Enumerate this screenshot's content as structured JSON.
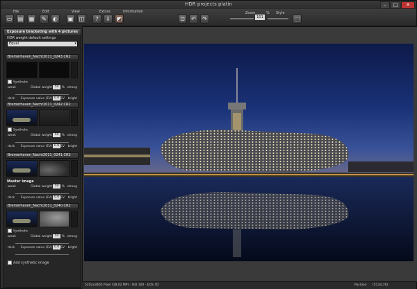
{
  "window": {
    "title": "HDR projects platin",
    "minimize": "–",
    "maximize": "□",
    "close": "✕"
  },
  "menu": [
    "File",
    "Edit",
    "View",
    "Extras",
    "Information"
  ],
  "toolbar": {
    "zoom_label": "Zoom",
    "zoom_value": "101",
    "zoom_unit": "%",
    "style_label": "Style"
  },
  "panel": {
    "title": "Exposure bracketing with 4 pictures",
    "weight_header": "HDR weight default settings",
    "weight_select": "Equal",
    "groups": [
      {
        "filename": "Bremerhaven_Nacht2011_0243.CR2",
        "synthetic": "Synthetic",
        "global_weight_label": "Global weight",
        "global_weight": "50",
        "exposure_label": "Exposure value (EV)",
        "exposure": "0.0",
        "weak": "weak",
        "strong": "strong",
        "dark": "dark",
        "bright": "bright",
        "pct": "%",
        "ev": "EV"
      },
      {
        "filename": "Bremerhaven_Nacht2011_0242.CR2",
        "synthetic": "Synthetic",
        "global_weight_label": "Global weight",
        "global_weight": "50",
        "exposure_label": "Exposure value (EV)",
        "exposure": "0.0",
        "weak": "weak",
        "strong": "strong",
        "dark": "dark",
        "bright": "bright",
        "pct": "%",
        "ev": "EV"
      },
      {
        "filename": "Bremerhaven_Nacht2011_0241.CR2",
        "master": "Master image",
        "global_weight_label": "Global weight",
        "global_weight": "50",
        "exposure_label": "Exposure value (EV)",
        "exposure": "0.0",
        "weak": "weak",
        "strong": "strong",
        "dark": "dark",
        "bright": "bright",
        "pct": "%",
        "ev": "EV"
      },
      {
        "filename": "Bremerhaven_Nacht2011_0240.CR2",
        "synthetic": "Synthetic",
        "global_weight_label": "Global weight",
        "global_weight": "50",
        "exposure_label": "Exposure value (EV)",
        "exposure": "0.0",
        "weak": "weak",
        "strong": "strong",
        "dark": "dark",
        "bright": "bright",
        "pct": "%",
        "ev": "EV"
      }
    ],
    "add_synthetic": "Add synthetic image"
  },
  "status": {
    "info": "5202x3465 Pixel (18.02 MP) · ISO 100 · EOS 7D",
    "position_label": "Position",
    "position_value": "(5134,76)"
  }
}
